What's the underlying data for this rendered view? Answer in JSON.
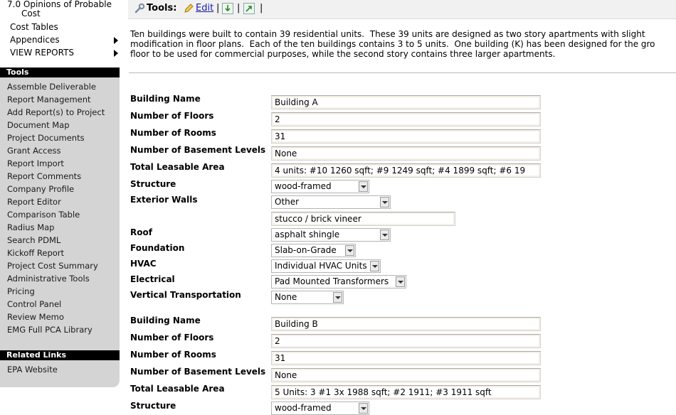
{
  "nav": {
    "items": [
      {
        "label": "7.0 Opinions of Probable",
        "label2": "Cost",
        "arrow": false
      },
      {
        "label": "Cost Tables",
        "arrow": false
      },
      {
        "label": "Appendices",
        "arrow": true
      },
      {
        "label": "VIEW REPORTS",
        "arrow": true
      }
    ]
  },
  "tools": {
    "header": "Tools",
    "items": [
      "Assemble Deliverable",
      "Report Management",
      "Add Report(s) to Project",
      "Document Map",
      "Project Documents",
      "Grant Access",
      "Report Import",
      "Report Comments",
      "Company Profile",
      "Report Editor",
      "Comparison Table",
      "Radius Map",
      "Search PDML",
      "Kickoff Report",
      "Project Cost Summary",
      "Administrative Tools",
      "Pricing",
      "Control Panel",
      "Review Memo",
      "EMG Full PCA Library"
    ]
  },
  "related": {
    "header": "Related Links",
    "items": [
      "EPA Website"
    ]
  },
  "toolbar": {
    "label": "Tools:",
    "edit": "Edit",
    "sep": "|"
  },
  "intro": {
    "line1": "Ten buildings were built to contain 39 residential units.  These 39 units are designed as two story apartments with slight",
    "line2": "modification in floor plans.  Each of the ten buildings contains 3 to 5 units.  One building (K) has been designed for the gro",
    "line3": "floor to be used for commercial purposes, while the second story contains three larger apartments."
  },
  "labels": {
    "building_name": "Building Name",
    "floors": "Number of Floors",
    "rooms": "Number of Rooms",
    "basement": "Number of Basement Levels",
    "area": "Total Leasable Area",
    "structure": "Structure",
    "walls": "Exterior Walls",
    "roof": "Roof",
    "foundation": "Foundation",
    "hvac": "HVAC",
    "electrical": "Electrical",
    "vertical": "Vertical Transportation"
  },
  "building_a": {
    "name": "Building A",
    "floors": "2",
    "rooms": "31",
    "basement": "None",
    "area": "4 units: #10 1260 sqft; #9 1249 sqft; #4 1899 sqft; #6 19",
    "structure": "wood-framed",
    "walls": "Other",
    "walls_other": "stucco / brick vineer",
    "roof": "asphalt shingle",
    "foundation": "Slab-on-Grade",
    "hvac": "Individual HVAC Units",
    "electrical": "Pad Mounted Transformers",
    "vertical": "None"
  },
  "building_b": {
    "name": "Building B",
    "floors": "2",
    "rooms": "31",
    "basement": "None",
    "area": "5 Units: 3 #1  3x 1988 sqft;  #2 1911;  #3  1911 sqft",
    "structure": "wood-framed"
  }
}
